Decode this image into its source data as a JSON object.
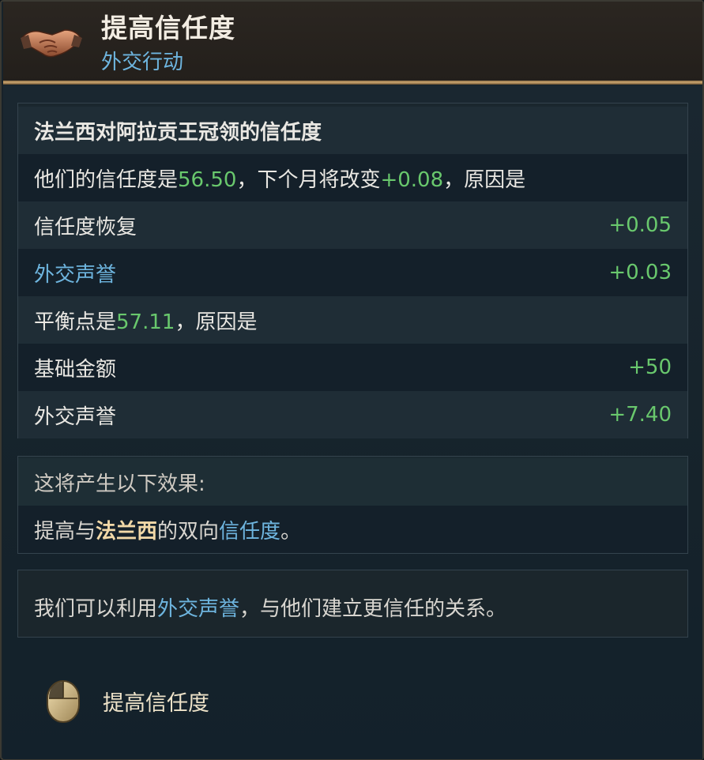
{
  "header": {
    "title": "提高信任度",
    "subtitle": "外交行动",
    "icon": "handshake-icon"
  },
  "trust_panel": {
    "heading": "法兰西对阿拉贡王冠领的信任度",
    "summary_prefix": "他们的信任度是",
    "trust_value": "56.50",
    "summary_mid": "，下个月将改变",
    "trust_change": "+0.08",
    "summary_suffix": "，原因是",
    "change_factors": [
      {
        "label": "信任度恢复",
        "value": "+0.05"
      },
      {
        "label": "外交声誉",
        "value": "+0.03"
      }
    ],
    "equilibrium_prefix": "平衡点是",
    "equilibrium_value": "57.11",
    "equilibrium_suffix": "，原因是",
    "equilibrium_factors": [
      {
        "label": "基础金额",
        "value": "+50"
      },
      {
        "label": "外交声誉",
        "value": "+7.40"
      }
    ]
  },
  "effects_panel": {
    "heading": "这将产生以下效果:",
    "effect_prefix": "提高与",
    "effect_country": "法兰西",
    "effect_mid": "的双向",
    "effect_link": "信任度",
    "effect_suffix": "。"
  },
  "note_panel": {
    "prefix": "我们可以利用",
    "link": "外交声誉",
    "suffix": "，与他们建立更信任的关系。"
  },
  "action": {
    "icon": "mouse-icon",
    "label": "提高信任度"
  },
  "colors": {
    "positive": "#69c86d",
    "link": "#6eb5df",
    "highlight": "#f2d9a8"
  }
}
